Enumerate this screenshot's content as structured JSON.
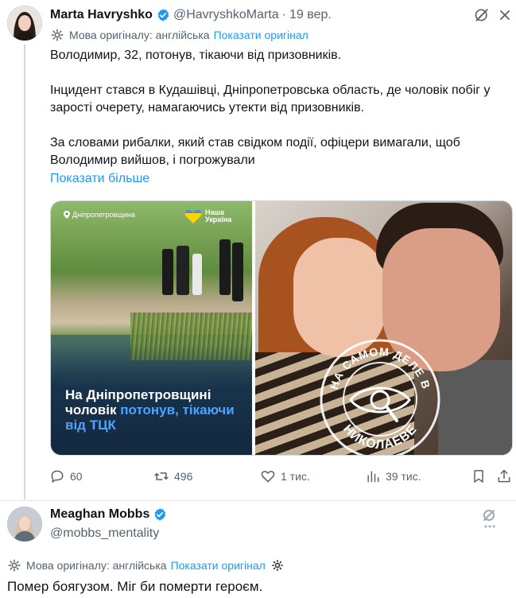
{
  "tweet": {
    "author_name": "Marta Havryshko",
    "handle": "@HavryshkoMarta",
    "separator": "·",
    "date": "19 вер.",
    "translation": {
      "label": "Мова оригіналу: англійська",
      "link": "Показати оригінал"
    },
    "paragraphs": [
      "Володимир, 32, потонув, тікаючи від призовників.",
      "Інцидент стався в Кудашівці, Дніпропетровська область, де чоловік побіг у зарості очерету, намагаючись утекти від призовників.",
      "За словами рибалки, який став свідком події, офіцери вимагали, щоб Володимир вийшов, і погрожували"
    ],
    "show_more": "Показати більше",
    "media": {
      "left": {
        "location": "Дніпропетровщина",
        "brand_line1": "Наша",
        "brand_line2": "Україна",
        "headline_part1": "На Дніпропетровщині чоловік ",
        "headline_highlight": "потонув, тікаючи від ТЦК"
      },
      "right": {
        "watermark_top": "НА САМОМ ДЕЛЕ В",
        "watermark_bottom": "НИКОЛАЕВЕ"
      }
    },
    "stats": {
      "replies": "60",
      "reposts": "496",
      "likes": "1 тис.",
      "views": "39 тис."
    }
  },
  "reply": {
    "author_name": "Meaghan Mobbs",
    "handle": "@mobbs_mentality",
    "translation": {
      "label": "Мова оригіналу: англійська",
      "link": "Показати оригінал"
    },
    "text": "Помер боягузом. Міг би померти героєм."
  },
  "colors": {
    "accent": "#1d9bf0",
    "text": "#0f1419",
    "muted": "#536471",
    "verified": "#1d9bf0"
  }
}
